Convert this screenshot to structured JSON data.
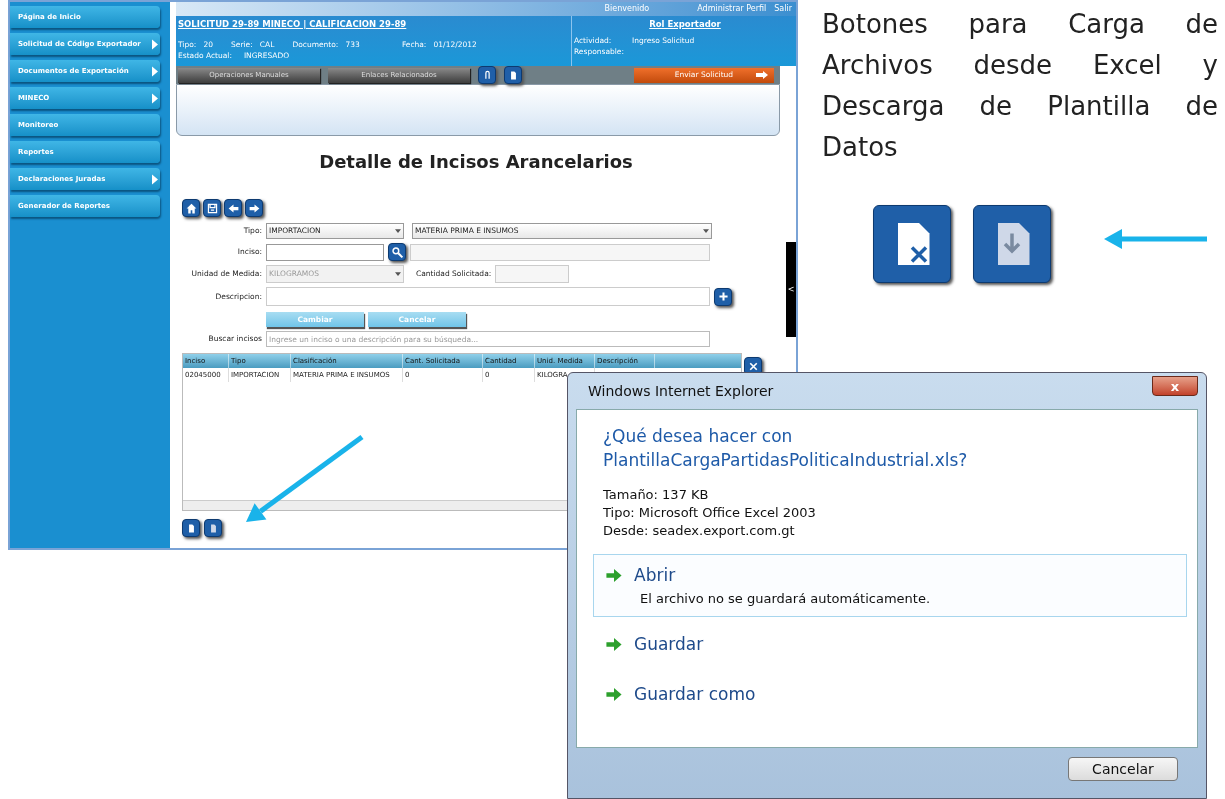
{
  "sidebar": {
    "items": [
      {
        "label": "Página de Inicio",
        "expandable": false
      },
      {
        "label": "Solicitud de Código Exportador",
        "expandable": true
      },
      {
        "label": "Documentos de Exportación",
        "expandable": true
      },
      {
        "label": "MINECO",
        "expandable": true
      },
      {
        "label": "Monitoreo",
        "expandable": false
      },
      {
        "label": "Reportes",
        "expandable": false
      },
      {
        "label": "Declaraciones Juradas",
        "expandable": true
      },
      {
        "label": "Generador de Reportes",
        "expandable": false
      }
    ]
  },
  "top_bar": {
    "welcome": "Bienvenido",
    "links": [
      "Administrar Perfil",
      "Salir"
    ]
  },
  "header": {
    "title": "SOLICITUD 29-89 MINECO | CALIFICACION 29-89",
    "role": "Rol Exportador",
    "fields": [
      {
        "label": "Tipo:",
        "value": "20"
      },
      {
        "label": "Serie:",
        "value": "CAL"
      },
      {
        "label": "Documento:",
        "value": "733"
      },
      {
        "label": "Fecha:",
        "value": "01/12/2012"
      }
    ],
    "status": {
      "label": "Estado Actual:",
      "value": "INGRESADO"
    },
    "right_fields": [
      {
        "label": "Actividad:",
        "value": "Ingreso Solicitud"
      },
      {
        "label": "Responsable:"
      }
    ]
  },
  "toolbar": {
    "tabs": [
      "Operaciones Manuales",
      "Enlaces Relacionados"
    ],
    "send_button": "Enviar Solicitud"
  },
  "page_title": "Detalle de Incisos Arancelarios",
  "form": {
    "tipo_label": "Tipo:",
    "tipo_value": "IMPORTACION",
    "clasificacion_value": "MATERIA PRIMA E INSUMOS",
    "inciso_label": "Inciso:",
    "unidad_label": "Unidad de Medida:",
    "unidad_value": "KILOGRAMOS",
    "cantidad_label": "Cantidad Solicitada:",
    "descripcion_label": "Descripcion:",
    "buttons": [
      "Cambiar",
      "Cancelar"
    ],
    "buscar_label": "Buscar incisos",
    "buscar_placeholder": "Ingrese un inciso o una descripción para su búsqueda..."
  },
  "table": {
    "columns": [
      "Inciso",
      "Tipo",
      "Clasificación",
      "Cant. Solicitada",
      "Cantidad",
      "Unid. Medida",
      "Descripción"
    ],
    "rows": [
      [
        "02045000",
        "IMPORTACION",
        "MATERIA PRIMA E INSUMOS",
        "0",
        "0",
        "KILOGRA"
      ]
    ]
  },
  "side_tab": "<",
  "annotation": "Botones para Carga de Archivos desde Excel y Descarga de Plantilla de Datos",
  "dialog": {
    "title": "Windows Internet Explorer",
    "close": "x",
    "question": "¿Qué desea hacer con PlantillaCargaPartidasPoliticaIndustrial.xls?",
    "info": [
      "Tamaño: 137 KB",
      "Tipo: Microsoft Office Excel 2003",
      "Desde: seadex.export.com.gt"
    ],
    "options": [
      {
        "label": "Abrir",
        "note": "El archivo no se guardará automáticamente.",
        "selected": true
      },
      {
        "label": "Guardar",
        "selected": false
      },
      {
        "label": "Guardar como",
        "selected": false
      }
    ],
    "cancel": "Cancelar"
  }
}
